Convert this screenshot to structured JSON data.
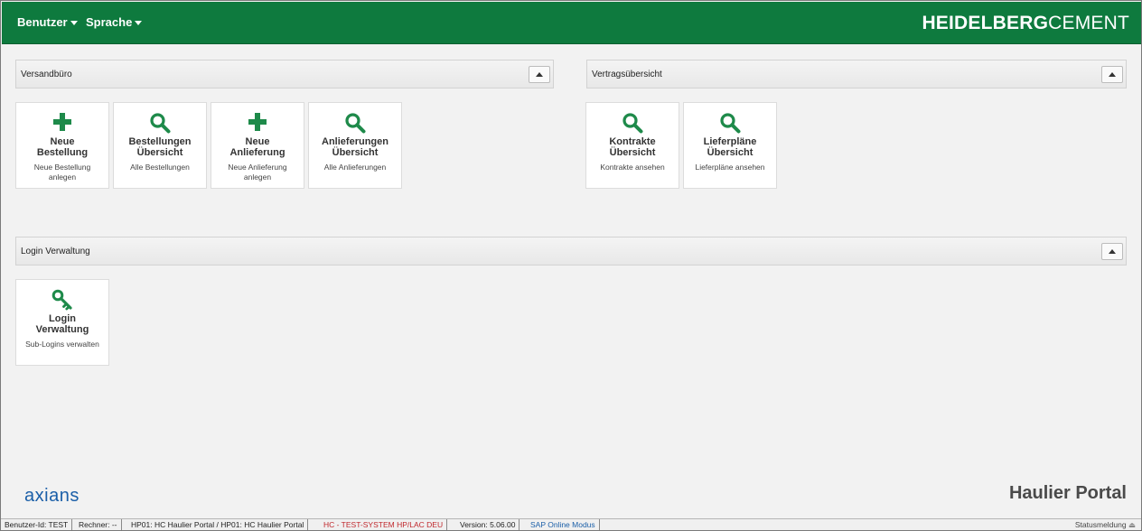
{
  "header": {
    "menus": [
      {
        "label": "Benutzer"
      },
      {
        "label": "Sprache"
      }
    ],
    "brand_bold": "HEIDELBERG",
    "brand_light": "CEMENT"
  },
  "sections": {
    "versandbuero": {
      "title": "Versandbüro",
      "tiles": [
        {
          "icon": "plus-icon",
          "title": "Neue\nBestellung",
          "desc": "Neue Bestellung\nanlegen"
        },
        {
          "icon": "search-icon",
          "title": "Bestellungen\nÜbersicht",
          "desc": "Alle Bestellungen"
        },
        {
          "icon": "plus-icon",
          "title": "Neue\nAnlieferung",
          "desc": "Neue Anlieferung\nanlegen"
        },
        {
          "icon": "search-icon",
          "title": "Anlieferungen\nÜbersicht",
          "desc": "Alle Anlieferungen"
        }
      ]
    },
    "vertrag": {
      "title": "Vertragsübersicht",
      "tiles": [
        {
          "icon": "search-icon",
          "title": "Kontrakte\nÜbersicht",
          "desc": "Kontrakte ansehen"
        },
        {
          "icon": "search-icon",
          "title": "Lieferpläne\nÜbersicht",
          "desc": "Lieferpläne ansehen"
        }
      ]
    },
    "login": {
      "title": "Login Verwaltung",
      "tiles": [
        {
          "icon": "key-icon",
          "title": "Login\nVerwaltung",
          "desc": "Sub-Logins verwalten"
        }
      ]
    }
  },
  "footer": {
    "logo_text": "axians",
    "portal_title": "Haulier Portal"
  },
  "statusbar": {
    "items": [
      "Benutzer-Id: TEST",
      "Rechner: --",
      "HP01: HC Haulier Portal / HP01: HC Haulier Portal",
      "HC - TEST-SYSTEM HP/LAC DEU",
      "Version: 5.06.00",
      "SAP Online Modus"
    ],
    "right_label": "Statusmeldung"
  },
  "colors": {
    "header_green": "#0e7a3e",
    "icon_green": "#1e8a4a",
    "status_red": "#c0282d",
    "status_blue": "#1b5fa8"
  }
}
